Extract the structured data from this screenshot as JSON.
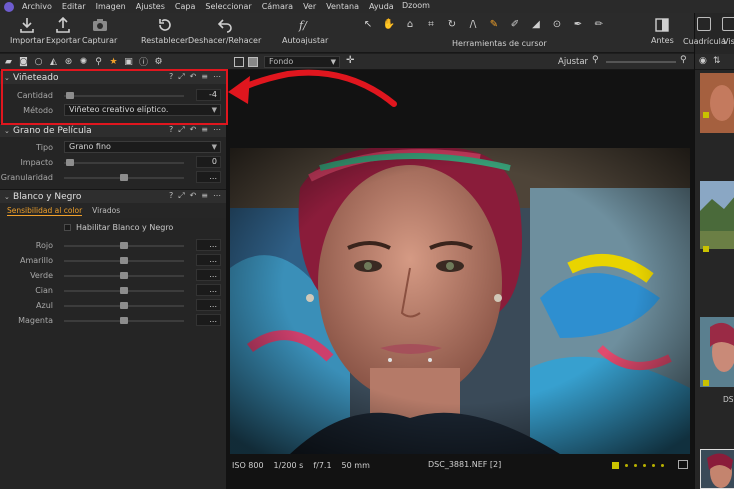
{
  "menu": {
    "items": [
      "Archivo",
      "Editar",
      "Imagen",
      "Ajustes",
      "Capa",
      "Seleccionar",
      "Cámara",
      "Ver",
      "Ventana",
      "Ayuda"
    ],
    "app_title": "Dzoom"
  },
  "toolbar": {
    "importar": "Importar",
    "exportar": "Exportar",
    "capturar": "Capturar",
    "restablecer": "Restablecer",
    "deshacer_rehacer": "Deshacer/Rehacer",
    "autoajustar": "Autoajustar",
    "herramientas_cursor": "Herramientas de cursor",
    "antes": "Antes",
    "cuadricula": "Cuadrícula",
    "vista": "Vis"
  },
  "tool_tabs": [
    "folder-icon",
    "camera-icon",
    "circle-icon",
    "exposure-icon",
    "color-icon",
    "detail-icon",
    "lens-icon",
    "star-icon",
    "metadata-icon",
    "info-icon",
    "settings-icon"
  ],
  "vignetting": {
    "title": "Viñeteado",
    "amount_label": "Cantidad",
    "amount_value": "-4",
    "amount_fraction": 0.02,
    "method_label": "Método",
    "method_value": "Viñeteo creativo elíptico."
  },
  "film_grain": {
    "title": "Grano de Película",
    "type_label": "Tipo",
    "type_value": "Grano fino",
    "impact_label": "Impacto",
    "impact_value": "0",
    "impact_fraction": 0.02,
    "granularity_label": "Granularidad",
    "granularity_value": "...",
    "granularity_fraction": 0.5
  },
  "black_white": {
    "title": "Blanco y Negro",
    "tab_sensitivity": "Sensibilidad al color",
    "tab_toning": "Virados",
    "enable_label": "Habilitar Blanco y Negro",
    "channels": [
      {
        "label": "Rojo",
        "value": "...",
        "fraction": 0.5
      },
      {
        "label": "Amarillo",
        "value": "...",
        "fraction": 0.5
      },
      {
        "label": "Verde",
        "value": "...",
        "fraction": 0.5
      },
      {
        "label": "Cian",
        "value": "...",
        "fraction": 0.5
      },
      {
        "label": "Azul",
        "value": "...",
        "fraction": 0.5
      },
      {
        "label": "Magenta",
        "value": "...",
        "fraction": 0.5
      }
    ]
  },
  "viewer": {
    "mode_select": "Fondo",
    "fit_label": "Ajustar",
    "iso": "ISO 800",
    "shutter": "1/200 s",
    "aperture": "f/7.1",
    "focal": "50 mm",
    "filename": "DSC_3881.NEF [2]"
  },
  "browser": {
    "caption": "DS"
  },
  "colors": {
    "accent": "#f0a02a",
    "highlight": "#e0161e",
    "rating_yellow": "#c9c200"
  }
}
